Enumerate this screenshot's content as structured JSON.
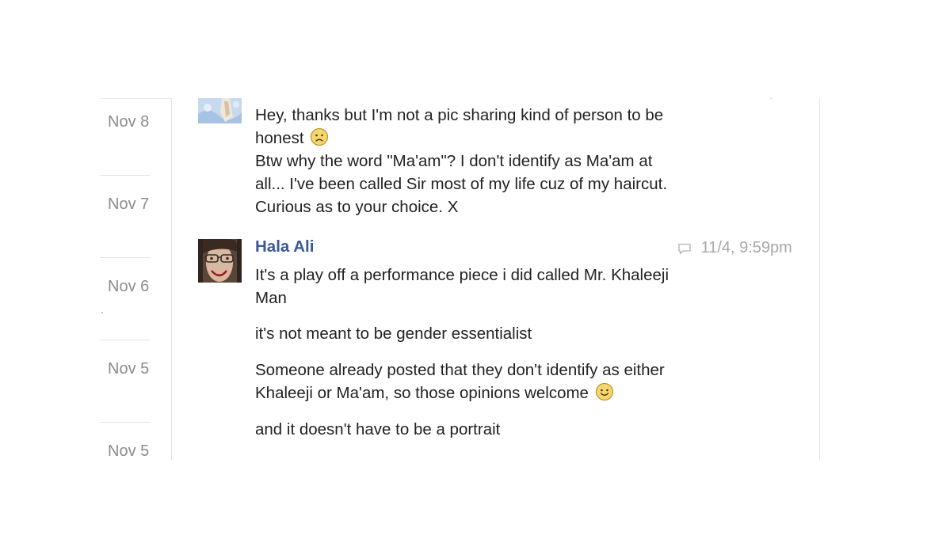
{
  "sidebar": {
    "dates": [
      {
        "label": "Nov 8"
      },
      {
        "label": "Nov 7"
      },
      {
        "label": "Nov 6"
      },
      {
        "label": "Nov 5"
      },
      {
        "label": "Nov 5"
      }
    ]
  },
  "conversation": {
    "previous_message": {
      "lines": [
        "Hey, thanks but I'm not a pic sharing kind of person to be",
        "honest",
        "Btw why the word \"Ma'am\"? I don't identify as Ma'am at",
        "all... I've been called Sir most of my life cuz of my haircut.",
        "Curious as to your choice. X"
      ],
      "emoji": "frown-emoji"
    },
    "reply": {
      "sender": "Hala Ali",
      "timestamp": "11/4, 9:59pm",
      "timestamp_icon": "chat-bubble-icon",
      "paragraphs": [
        [
          "It's a play off a performance piece i did called Mr. Khaleeji",
          "Man"
        ],
        [
          "it's not meant to be gender essentialist"
        ],
        [
          "Someone already posted that they don't identify as either",
          "Khaleeji or Ma'am, so those opinions welcome"
        ],
        [
          "and it doesn't have to be a portrait"
        ]
      ],
      "emoji": "smile-emoji"
    }
  },
  "colors": {
    "name_link": "#3b5998",
    "body_text": "#222222",
    "muted_text": "#8c8c8c",
    "timestamp_text": "#a8a8a8",
    "divider": "#e4e4e4",
    "emoji_face": "#f5d76e"
  }
}
